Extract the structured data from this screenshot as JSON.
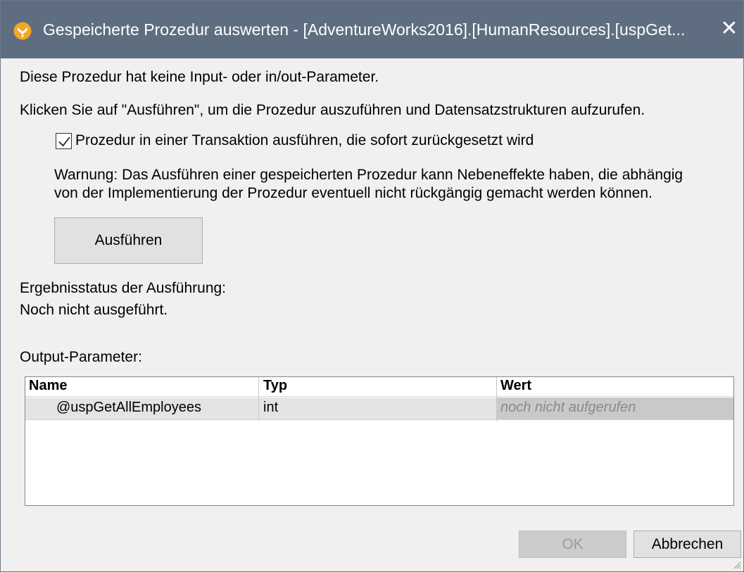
{
  "window": {
    "title": "Gespeicherte Prozedur auswerten - [AdventureWorks2016].[HumanResources].[uspGet...",
    "app_icon": "altova-logo-icon",
    "close_glyph": "✕"
  },
  "content": {
    "info_line": "Diese Prozedur hat keine Input- oder in/out-Parameter.",
    "instruction_line": "Klicken Sie auf \"Ausführen\", um die Prozedur auszuführen und Datensatzstrukturen aufzurufen.",
    "transaction_checkbox": {
      "label": "Prozedur in einer Transaktion ausführen, die sofort zurückgesetzt wird",
      "checked": true
    },
    "warning_line1": "Warnung: Das Ausführen einer gespeicherten Prozedur kann Nebeneffekte haben, die abhängig",
    "warning_line2": "von der Implementierung der Prozedur eventuell nicht rückgängig gemacht werden können.",
    "run_button": "Ausführen",
    "status_label": "Ergebnisstatus der Ausführung:",
    "status_value": "Noch nicht ausgeführt.",
    "output_label": "Output-Parameter:"
  },
  "output_table": {
    "columns": [
      "Name",
      "Typ",
      "Wert"
    ],
    "rows": [
      {
        "name": "@uspGetAllEmployees",
        "typ": "int",
        "wert": "noch nicht aufgerufen"
      }
    ]
  },
  "footer": {
    "ok_label": "OK",
    "ok_enabled": false,
    "cancel_label": "Abbrechen"
  },
  "colors": {
    "titlebar": "#5e6e80",
    "dialog_bg": "#f0f0f0",
    "app_icon": "#f5a623"
  }
}
